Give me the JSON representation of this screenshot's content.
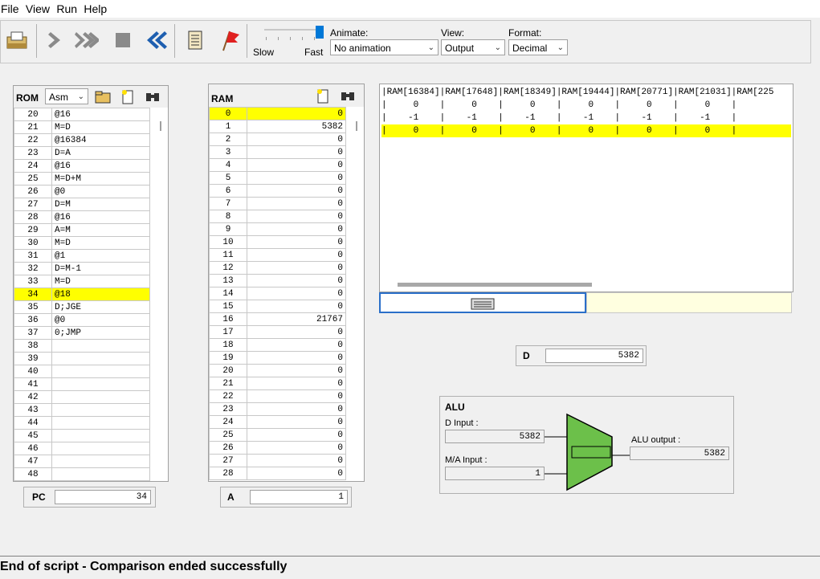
{
  "menu": [
    "File",
    "View",
    "Run",
    "Help"
  ],
  "toolbar": {
    "slider": {
      "slow": "Slow",
      "fast": "Fast",
      "value": 1.0
    },
    "animate": {
      "label": "Animate:",
      "value": "No animation"
    },
    "view": {
      "label": "View:",
      "value": "Output"
    },
    "format": {
      "label": "Format:",
      "value": "Decimal"
    }
  },
  "rom": {
    "title": "ROM",
    "mode": "Asm",
    "rows": [
      {
        "n": "20",
        "v": "@16"
      },
      {
        "n": "21",
        "v": "M=D"
      },
      {
        "n": "22",
        "v": "@16384"
      },
      {
        "n": "23",
        "v": "D=A"
      },
      {
        "n": "24",
        "v": "@16"
      },
      {
        "n": "25",
        "v": "M=D+M"
      },
      {
        "n": "26",
        "v": "@0"
      },
      {
        "n": "27",
        "v": "D=M"
      },
      {
        "n": "28",
        "v": "@16"
      },
      {
        "n": "29",
        "v": "A=M"
      },
      {
        "n": "30",
        "v": "M=D"
      },
      {
        "n": "31",
        "v": "@1"
      },
      {
        "n": "32",
        "v": "D=M-1"
      },
      {
        "n": "33",
        "v": "M=D"
      },
      {
        "n": "34",
        "v": "@18"
      },
      {
        "n": "35",
        "v": "D;JGE"
      },
      {
        "n": "36",
        "v": "@0"
      },
      {
        "n": "37",
        "v": "0;JMP"
      },
      {
        "n": "38",
        "v": ""
      },
      {
        "n": "39",
        "v": ""
      },
      {
        "n": "40",
        "v": ""
      },
      {
        "n": "41",
        "v": ""
      },
      {
        "n": "42",
        "v": ""
      },
      {
        "n": "43",
        "v": ""
      },
      {
        "n": "44",
        "v": ""
      },
      {
        "n": "45",
        "v": ""
      },
      {
        "n": "46",
        "v": ""
      },
      {
        "n": "47",
        "v": ""
      },
      {
        "n": "48",
        "v": ""
      }
    ],
    "highlight": "34"
  },
  "ram": {
    "title": "RAM",
    "rows": [
      {
        "n": "0",
        "v": "0"
      },
      {
        "n": "1",
        "v": "5382"
      },
      {
        "n": "2",
        "v": "0"
      },
      {
        "n": "3",
        "v": "0"
      },
      {
        "n": "4",
        "v": "0"
      },
      {
        "n": "5",
        "v": "0"
      },
      {
        "n": "6",
        "v": "0"
      },
      {
        "n": "7",
        "v": "0"
      },
      {
        "n": "8",
        "v": "0"
      },
      {
        "n": "9",
        "v": "0"
      },
      {
        "n": "10",
        "v": "0"
      },
      {
        "n": "11",
        "v": "0"
      },
      {
        "n": "12",
        "v": "0"
      },
      {
        "n": "13",
        "v": "0"
      },
      {
        "n": "14",
        "v": "0"
      },
      {
        "n": "15",
        "v": "0"
      },
      {
        "n": "16",
        "v": "21767"
      },
      {
        "n": "17",
        "v": "0"
      },
      {
        "n": "18",
        "v": "0"
      },
      {
        "n": "19",
        "v": "0"
      },
      {
        "n": "20",
        "v": "0"
      },
      {
        "n": "21",
        "v": "0"
      },
      {
        "n": "22",
        "v": "0"
      },
      {
        "n": "23",
        "v": "0"
      },
      {
        "n": "24",
        "v": "0"
      },
      {
        "n": "25",
        "v": "0"
      },
      {
        "n": "26",
        "v": "0"
      },
      {
        "n": "27",
        "v": "0"
      },
      {
        "n": "28",
        "v": "0"
      }
    ],
    "highlight": "0"
  },
  "output": {
    "lines": [
      "|RAM[16384]|RAM[17648]|RAM[18349]|RAM[19444]|RAM[20771]|RAM[21031]|RAM[225",
      "|     0    |     0    |     0    |     0    |     0    |     0    |",
      "|    -1    |    -1    |    -1    |    -1    |    -1    |    -1    |",
      "|     0    |     0    |     0    |     0    |     0    |     0    |"
    ],
    "highlight_line": 3
  },
  "pc": {
    "label": "PC",
    "value": "34"
  },
  "a": {
    "label": "A",
    "value": "1"
  },
  "d": {
    "label": "D",
    "value": "5382"
  },
  "alu": {
    "title": "ALU",
    "d_label": "D Input :",
    "d_value": "5382",
    "ma_label": "M/A Input :",
    "ma_value": "1",
    "out_label": "ALU output :",
    "out_value": "5382",
    "color": "#6cc04a"
  },
  "status": "End of script - Comparison ended successfully",
  "colors": {
    "highlight": "#ffff00",
    "accent": "#0078d7"
  }
}
